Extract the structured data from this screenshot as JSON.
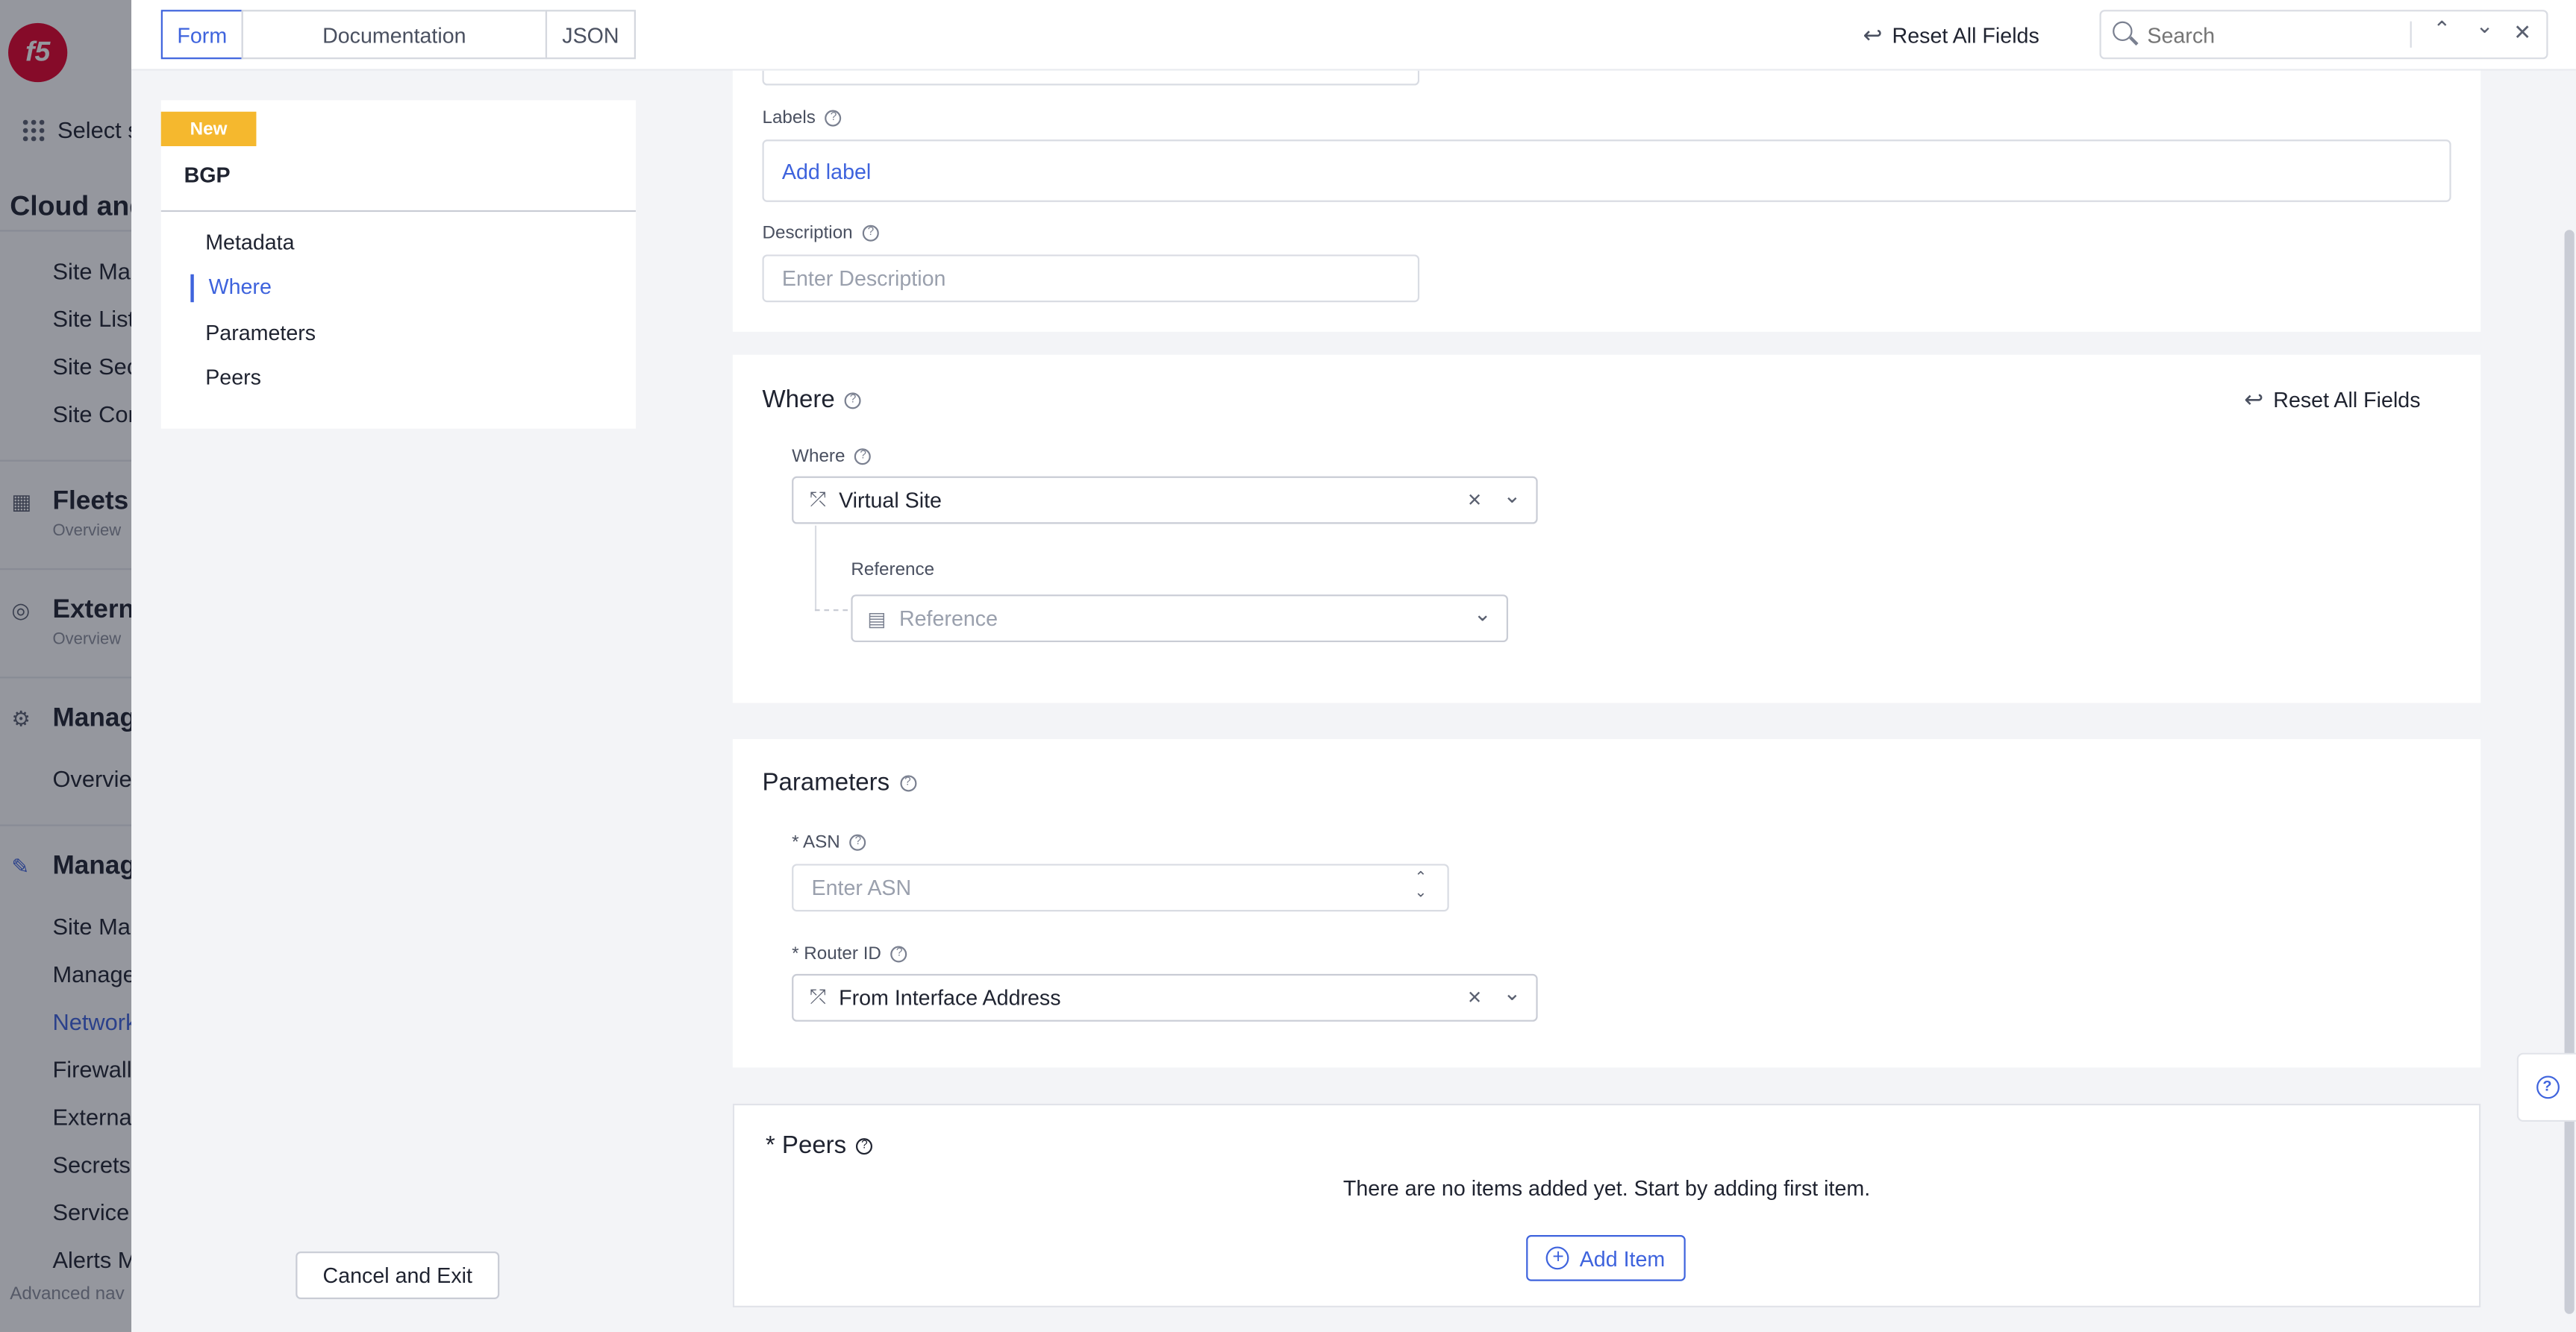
{
  "background_nav": {
    "select_label": "Select s",
    "section_title": "Cloud and",
    "items_a": [
      "Site Map",
      "Site List",
      "Site Sec",
      "Site Con"
    ],
    "fleets": {
      "title": "Fleets",
      "sub": "Overview"
    },
    "external": {
      "title": "Externa",
      "sub": "Overview"
    },
    "manage1": {
      "title": "Manag",
      "item": "Overvie"
    },
    "manage2": {
      "title": "Manag",
      "items": [
        "Site Man",
        "Manage",
        "Network",
        "Firewall",
        "External",
        "Secrets",
        "Service",
        "Alerts M"
      ]
    },
    "footer": "Advanced nav"
  },
  "tabs": [
    "Form",
    "Documentation",
    "JSON"
  ],
  "top": {
    "reset_label": "Reset All Fields",
    "search_placeholder": "Search"
  },
  "outline": {
    "badge": "New",
    "title": "BGP",
    "items": [
      "Metadata",
      "Where",
      "Parameters",
      "Peers"
    ],
    "cancel_label": "Cancel and Exit"
  },
  "metadata": {
    "labels_label": "Labels",
    "add_label": "Add label",
    "description_label": "Description",
    "description_placeholder": "Enter Description"
  },
  "where": {
    "heading": "Where",
    "reset_label": "Reset All Fields",
    "field_label": "Where",
    "value": "Virtual Site",
    "reference_label": "Reference",
    "reference_placeholder": "Reference"
  },
  "parameters": {
    "heading": "Parameters",
    "asn_label": "* ASN",
    "asn_placeholder": "Enter ASN",
    "router_label": "* Router ID",
    "router_value": "From Interface Address"
  },
  "peers": {
    "heading": "* Peers",
    "empty_text": "There are no items added yet. Start by adding first item.",
    "add_label": "Add Item"
  },
  "colors": {
    "accent": "#3e63dd",
    "badge": "#f5b82e",
    "brand": "#e4002b"
  }
}
